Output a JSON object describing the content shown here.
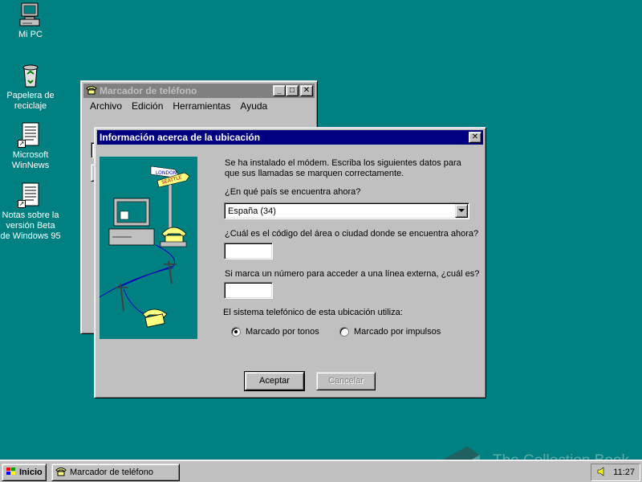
{
  "colors": {
    "desktop": "#008080",
    "active_title": "#000080",
    "inactive_title": "#808080"
  },
  "desktop_icons": [
    {
      "label": "Mi PC",
      "icon": "computer-icon"
    },
    {
      "label": "Papelera de reciclaje",
      "icon": "recycle-bin-icon"
    },
    {
      "label": "Microsoft WinNews",
      "icon": "document-shortcut-icon"
    },
    {
      "label": "Notas sobre la versión Beta de Windows 95",
      "icon": "document-shortcut-icon"
    }
  ],
  "dialer_window": {
    "title": "Marcador de teléfono",
    "menu": [
      "Archivo",
      "Edición",
      "Herramientas",
      "Ayuda"
    ]
  },
  "location_dialog": {
    "title": "Información acerca de la ubicación",
    "intro": "Se ha instalado el módem. Escriba los siguientes datos para que sus llamadas se marquen correctamente.",
    "country_question": "¿En qué país se encuentra ahora?",
    "country_value": "España (34)",
    "area_question": "¿Cuál es el código del área o ciudad donde se encuentra ahora?",
    "area_value": "",
    "outside_question": "Si marca un número para acceder a una línea externa, ¿cuál es?",
    "outside_value": "",
    "dial_system_label": "El sistema telefónico de esta ubicación utiliza:",
    "tone_label": "Marcado por tonos",
    "pulse_label": "Marcado por impulsos",
    "selected_dialing": "tone",
    "ok_label": "Aceptar",
    "cancel_label": "Cancelar",
    "illustration_signs": [
      "LONDON",
      "SEATTLE"
    ]
  },
  "taskbar": {
    "start_label": "Inicio",
    "task_label": "Marcador de teléfono",
    "clock": "11:27"
  },
  "watermark": "The Collection Book"
}
